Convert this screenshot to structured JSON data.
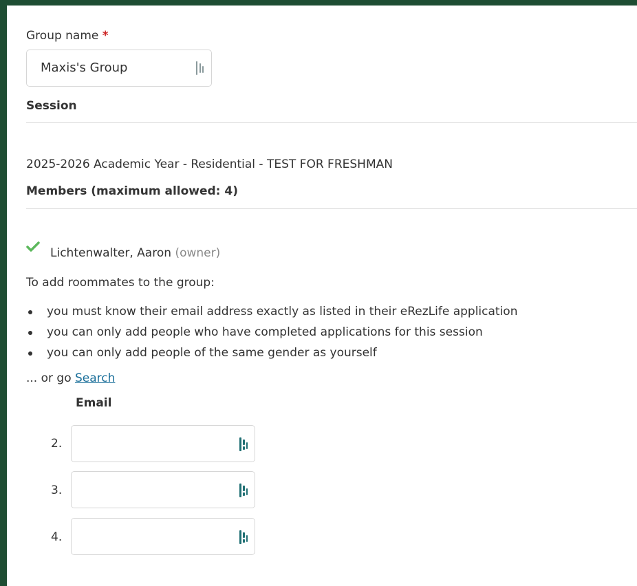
{
  "form": {
    "group_name_label": "Group name",
    "required_marker": "*",
    "group_name_value": "Maxis's Group",
    "session_label": "Session",
    "session_value": "2025-2026 Academic Year - Residential - TEST FOR FRESHMAN",
    "members_label": "Members (maximum allowed: 4)"
  },
  "owner": {
    "name": "Lichtenwalter, Aaron",
    "role": "(owner)",
    "icon": "check-icon"
  },
  "instructions": {
    "intro": "To add roommates to the group:",
    "bullets": [
      "you must know their email address exactly as listed in their eRezLife application",
      "you can only add people who have completed applications for this session",
      "you can only add people of the same gender as yourself"
    ],
    "or_go_prefix": "... or go",
    "search_link": "Search"
  },
  "email_section": {
    "header": "Email",
    "rows": [
      {
        "number": "2.",
        "value": ""
      },
      {
        "number": "3.",
        "value": ""
      },
      {
        "number": "4.",
        "value": ""
      }
    ]
  },
  "colors": {
    "frame": "#1e4d33",
    "required": "#cc1f1f",
    "link": "#1a6f9a",
    "check": "#5cb85c",
    "icon_teal": "#1f6f73"
  }
}
